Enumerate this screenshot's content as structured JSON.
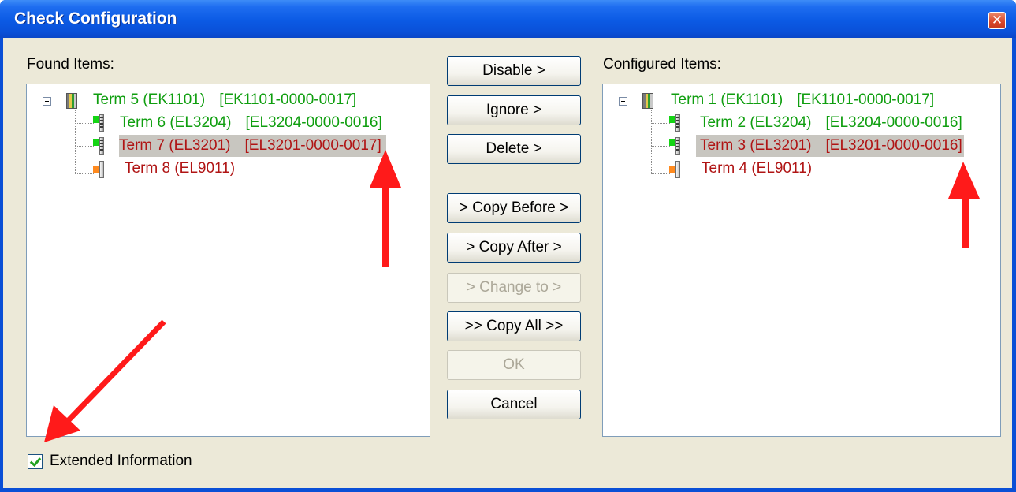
{
  "window": {
    "title": "Check Configuration",
    "close_glyph": "✕"
  },
  "found": {
    "label": "Found Items:",
    "items": [
      {
        "name": "Term 5 (EK1101)",
        "part": "[EK1101-0000-0017]",
        "color": "#0f9e0f",
        "icon": "coupler-icon"
      },
      {
        "name": "Term 6 (EL3204)",
        "part": "[EL3204-0000-0016]",
        "color": "#0f9e0f",
        "icon": "terminal-green-icon"
      },
      {
        "name": "Term 7 (EL3201)",
        "part": "[EL3201-0000-0017]",
        "color": "#b01414",
        "icon": "terminal-green-icon",
        "selected": true
      },
      {
        "name": "Term 8 (EL9011)",
        "part": "",
        "color": "#b01414",
        "icon": "terminal-orange-icon"
      }
    ]
  },
  "configured": {
    "label": "Configured Items:",
    "items": [
      {
        "name": "Term 1 (EK1101)",
        "part": "[EK1101-0000-0017]",
        "color": "#0f9e0f",
        "icon": "coupler-icon"
      },
      {
        "name": "Term 2 (EL3204)",
        "part": "[EL3204-0000-0016]",
        "color": "#0f9e0f",
        "icon": "terminal-green-icon"
      },
      {
        "name": "Term 3 (EL3201)",
        "part": "[EL3201-0000-0016]",
        "color": "#b01414",
        "icon": "terminal-green-icon",
        "selected": true
      },
      {
        "name": "Term 4 (EL9011)",
        "part": "",
        "color": "#b01414",
        "icon": "terminal-orange-icon"
      }
    ]
  },
  "buttons": {
    "disable": "Disable >",
    "ignore": "Ignore >",
    "delete": "Delete >",
    "copy_before": "> Copy Before >",
    "copy_after": "> Copy After >",
    "change_to": "> Change to >",
    "copy_all": ">> Copy All >>",
    "ok": "OK",
    "cancel": "Cancel"
  },
  "extended": {
    "label": "Extended Information",
    "checked": true
  },
  "colors": {
    "match": "#0f9e0f",
    "mismatch": "#b01414",
    "annotation_arrow": "#ff1a1a"
  }
}
